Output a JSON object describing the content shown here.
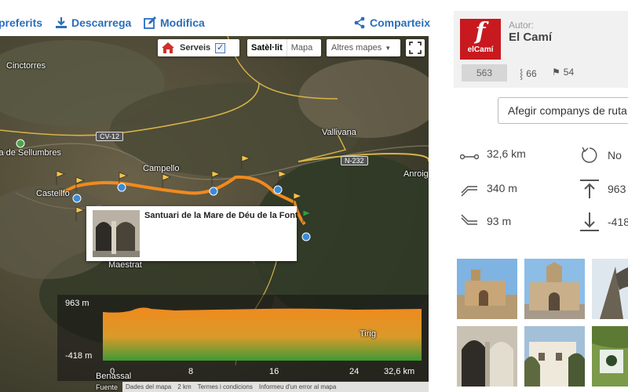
{
  "actions": {
    "favorites_label": "preferits",
    "download_label": "Descarrega",
    "edit_label": "Modifica",
    "share_label": "Comparteix"
  },
  "map": {
    "place_labels": [
      "Cinctorres",
      "la de Sellumbres",
      "Castellfo",
      "Campello",
      "Vallivana",
      "Anroig",
      "Maestrat",
      "Tirig",
      "Benassal"
    ],
    "roads": [
      "CV-12",
      "N-232"
    ],
    "controls": {
      "serveis_label": "Serveis",
      "serveis_checked": true,
      "satellite_label": "Satèl·lit",
      "map_label": "Mapa",
      "more_maps_label": "Altres mapes"
    },
    "poi": {
      "title": "Santuari de la Mare de Déu de la Font"
    },
    "profile": {
      "y_max": "963 m",
      "y_min": "-418 m",
      "x_ticks": [
        "0",
        "8",
        "16",
        "24",
        "32,6 km"
      ]
    },
    "attribution": [
      "Dades del mapa",
      "2 km",
      "Termes i condicions",
      "Informeu d'un error al mapa"
    ],
    "bottom_left_label": "Fuente"
  },
  "author": {
    "logo_text": "elCamí",
    "label": "Autor:",
    "name": "El Camí",
    "rank": "563",
    "routes_count": "66",
    "followers_count": "54"
  },
  "companions_button": "Afegir companys de ruta",
  "stats": {
    "distance": "32,6 km",
    "loop": "No",
    "ascent": "340 m",
    "max_altitude": "963",
    "descent": "93 m",
    "min_altitude": "-418"
  },
  "colors": {
    "link": "#2a6ebb",
    "route": "#f08a1e",
    "brand": "#c8191f"
  }
}
